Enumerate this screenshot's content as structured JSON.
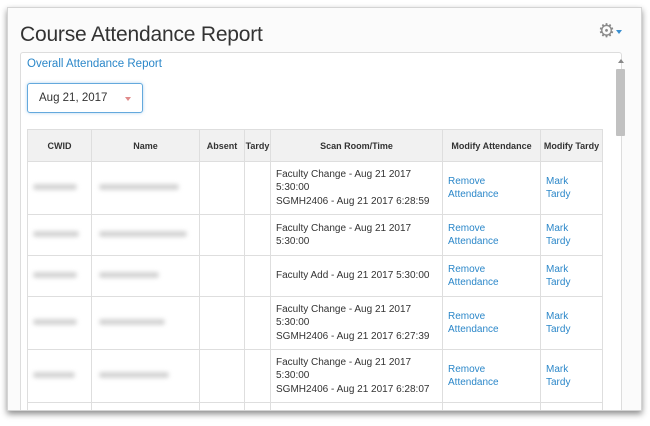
{
  "header": {
    "title": "Course Attendance Report",
    "settings_icon": "gear-icon"
  },
  "panel": {
    "overall_link": "Overall Attendance Report",
    "date_select": {
      "value": "Aug 21, 2017"
    }
  },
  "table": {
    "columns": [
      "CWID",
      "Name",
      "Absent",
      "Tardy",
      "Scan Room/Time",
      "Modify Attendance",
      "Modify Tardy"
    ],
    "rows": [
      {
        "scan": [
          "Faculty Change - Aug 21 2017",
          "5:30:00",
          "SGMH2406 - Aug 21 2017 6:28:59"
        ],
        "modify_attendance": [
          "Remove",
          "Attendance"
        ],
        "modify_tardy": [
          "Mark",
          "Tardy"
        ]
      },
      {
        "scan": [
          "Faculty Change - Aug 21 2017",
          "5:30:00"
        ],
        "modify_attendance": [
          "Remove",
          "Attendance"
        ],
        "modify_tardy": [
          "Mark",
          "Tardy"
        ]
      },
      {
        "scan": [
          "Faculty Add - Aug 21 2017 5:30:00"
        ],
        "modify_attendance": [
          "Remove",
          "Attendance"
        ],
        "modify_tardy": [
          "Mark",
          "Tardy"
        ]
      },
      {
        "scan": [
          "Faculty Change - Aug 21 2017",
          "5:30:00",
          "SGMH2406 - Aug 21 2017 6:27:39"
        ],
        "modify_attendance": [
          "Remove",
          "Attendance"
        ],
        "modify_tardy": [
          "Mark",
          "Tardy"
        ]
      },
      {
        "scan": [
          "Faculty Change - Aug 21 2017",
          "5:30:00",
          "SGMH2406 - Aug 21 2017 6:28:07"
        ],
        "modify_attendance": [
          "Remove",
          "Attendance"
        ],
        "modify_tardy": [
          "Mark",
          "Tardy"
        ]
      }
    ]
  }
}
